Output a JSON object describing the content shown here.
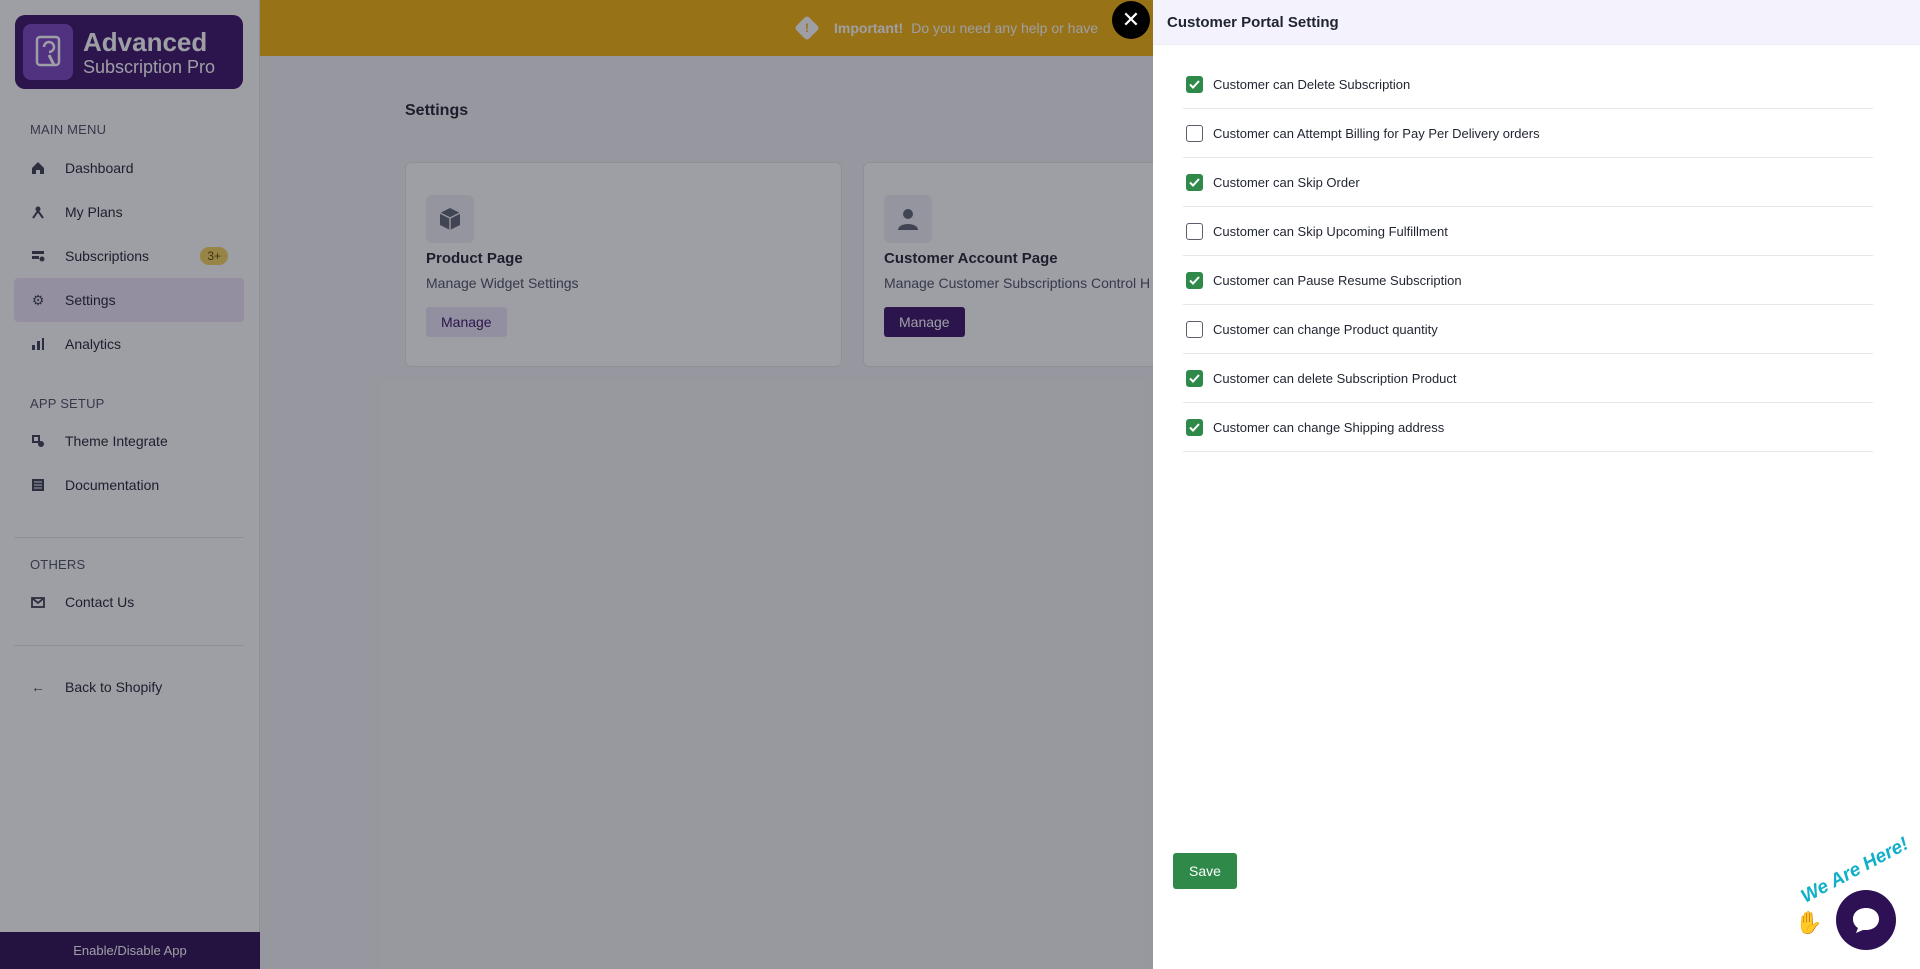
{
  "sidebar": {
    "logo_line1": "Advanced",
    "logo_line2": "Subscription Pro",
    "main_menu_heading": "MAIN MENU",
    "items": [
      {
        "label": "Dashboard",
        "icon": "home-icon"
      },
      {
        "label": "My Plans",
        "icon": "plans-icon"
      },
      {
        "label": "Subscriptions",
        "icon": "subscriptions-icon",
        "badge": "3+"
      },
      {
        "label": "Settings",
        "icon": "gear-icon",
        "active": true
      },
      {
        "label": "Analytics",
        "icon": "bar-chart-icon"
      }
    ],
    "app_setup_heading": "APP SETUP",
    "setup_items": [
      {
        "label": "Theme Integrate",
        "icon": "theme-icon"
      },
      {
        "label": "Documentation",
        "icon": "document-icon"
      }
    ],
    "others_heading": "OTHERS",
    "others_items": [
      {
        "label": "Contact Us",
        "icon": "mail-icon"
      }
    ],
    "back_label": "Back to Shopify",
    "enable_label": "Enable/Disable App"
  },
  "banner": {
    "important": "Important!",
    "message": "Do you need any help or have"
  },
  "page": {
    "title": "Settings",
    "cards": [
      {
        "title": "Product Page",
        "subtitle": "Manage Widget Settings",
        "button": "Manage"
      },
      {
        "title": "Customer Account Page",
        "subtitle": "Manage Customer Subscriptions Control H",
        "button": "Manage"
      }
    ]
  },
  "drawer": {
    "title": "Customer Portal Setting",
    "options": [
      {
        "label": "Customer can Delete Subscription",
        "checked": true
      },
      {
        "label": "Customer can Attempt Billing for Pay Per Delivery orders",
        "checked": false
      },
      {
        "label": "Customer can Skip Order",
        "checked": true
      },
      {
        "label": "Customer can Skip Upcoming Fulfillment",
        "checked": false
      },
      {
        "label": "Customer can Pause Resume Subscription",
        "checked": true
      },
      {
        "label": "Customer can change Product quantity",
        "checked": false
      },
      {
        "label": "Customer can delete Subscription Product",
        "checked": true
      },
      {
        "label": "Customer can change Shipping address",
        "checked": true
      }
    ],
    "save_label": "Save"
  },
  "chat": {
    "tagline": "We Are Here!"
  },
  "colors": {
    "brand": "#3a1467",
    "banner": "#f5b40b",
    "success": "#2f8a4a"
  }
}
